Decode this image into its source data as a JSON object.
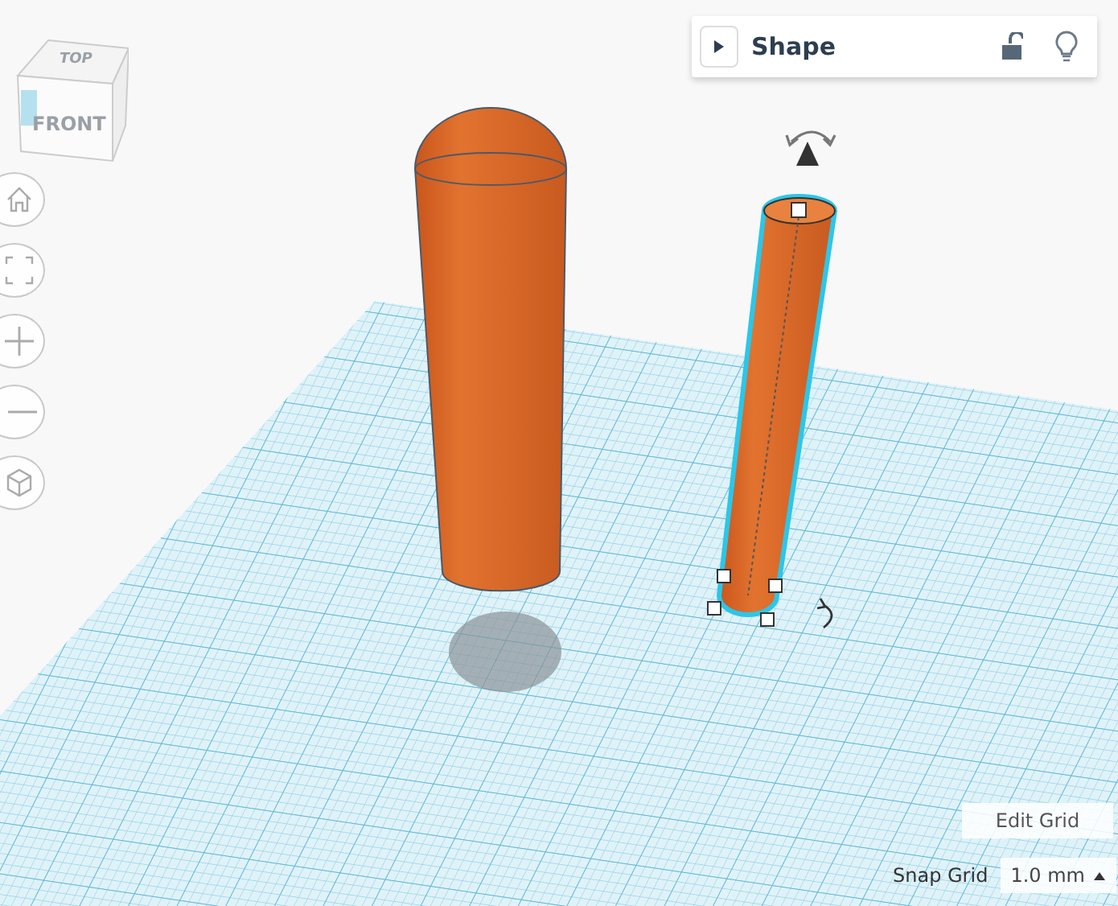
{
  "view_cube": {
    "top": "TOP",
    "front": "FRONT"
  },
  "view_controls": [
    {
      "kind": "home"
    },
    {
      "kind": "fit"
    },
    {
      "kind": "zoom_in"
    },
    {
      "kind": "zoom_out"
    },
    {
      "kind": "perspective"
    }
  ],
  "shape_panel": {
    "title": "Shape",
    "expanded": false,
    "locked": false
  },
  "edit_grid": {
    "label": "Edit Grid"
  },
  "snap_grid": {
    "label": "Snap Grid",
    "value": "1.0 mm"
  }
}
